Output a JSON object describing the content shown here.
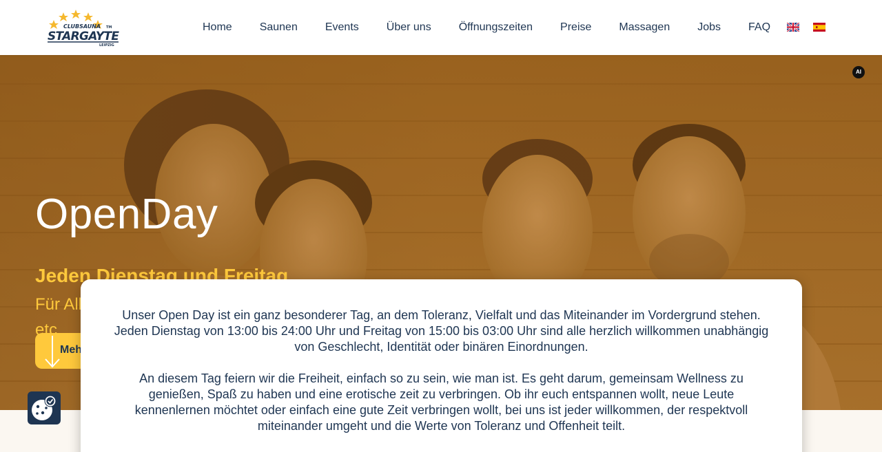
{
  "header": {
    "logo_text": "CLUBSAUNA STARGAYTE LEIPZIG",
    "nav": [
      {
        "label": "Home"
      },
      {
        "label": "Saunen"
      },
      {
        "label": "Events"
      },
      {
        "label": "Über uns"
      },
      {
        "label": "Öffnungszeiten"
      },
      {
        "label": "Preise"
      },
      {
        "label": "Massagen"
      },
      {
        "label": "Jobs"
      },
      {
        "label": "FAQ"
      }
    ],
    "languages": [
      "english-flag-icon",
      "spanish-flag-icon"
    ]
  },
  "hero": {
    "title": "OpenDay",
    "subtitle": "Jeden Dienstag und Freitag",
    "description": "Für Alle geöffnet egal ob Mann, Frau, hetero, homo, bi, etc.",
    "button_label": "Mehr",
    "ai_badge": "AI"
  },
  "card": {
    "paragraph_1": "Unser Open Day ist ein ganz besonderer Tag, an dem Toleranz, Vielfalt und das Miteinander im Vordergrund stehen. Jeden Dienstag von 13:00 bis 24:00 Uhr und Freitag von 15:00 bis 03:00 Uhr sind alle herzlich willkommen unabhängig von Geschlecht, Identität oder binären Einordnungen.",
    "paragraph_2": "An diesem Tag feiern wir die Freiheit, einfach so zu sein, wie man ist. Es geht darum, gemeinsam Wellness zu genießen, Spaß zu haben und eine erotische zeit zu verbringen. Ob ihr euch entspannen wollt, neue Leute kennenlernen möchtet oder einfach eine gute Zeit verbringen wollt, bei uns ist jeder willkommen, der respektvoll miteinander umgeht und die Werte von Toleranz und Offenheit teilt."
  },
  "colors": {
    "navy": "#1e3552",
    "accent_yellow": "#ffc93c",
    "hero_overlay": "#a66b22"
  },
  "cookie_button": {
    "icon": "cookie-settings-icon"
  }
}
